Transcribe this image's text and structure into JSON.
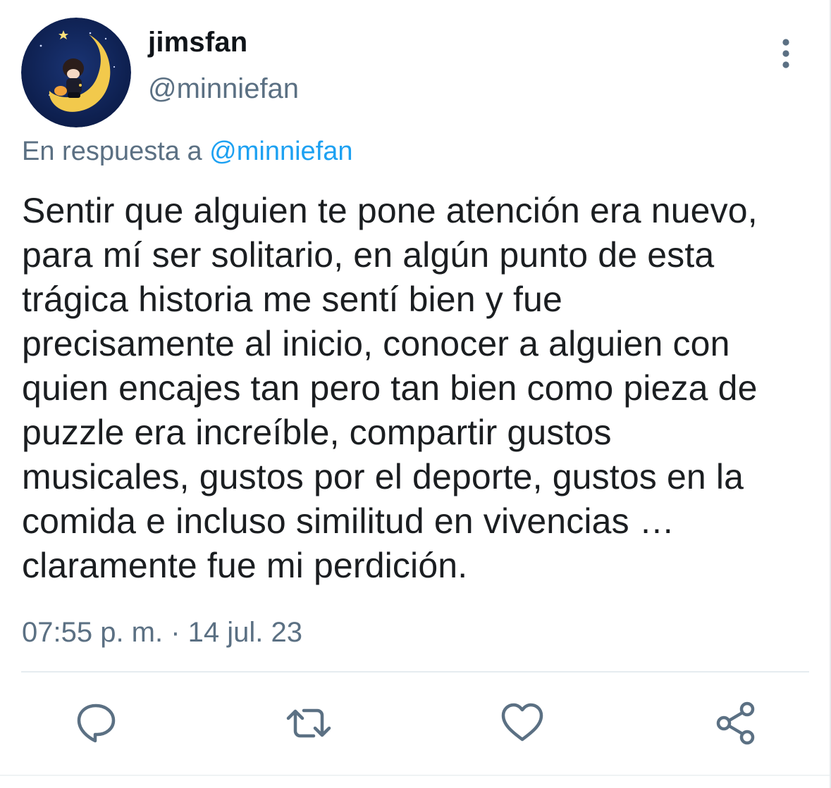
{
  "author": {
    "display_name": "jimsfan",
    "handle": "@minniefan",
    "avatar_icon": "moon-avatar"
  },
  "reply": {
    "prefix": "En respuesta a",
    "mention": "@minniefan"
  },
  "tweet": {
    "text": "Sentir que alguien te pone atención era nuevo,\npara mí ser solitario, en algún punto de esta\ntrágica historia me sentí bien y fue\nprecisamente al inicio, conocer a alguien con\nquien encajes tan pero tan bien como pieza de\npuzzle era increíble, compartir gustos\nmusicales, gustos por el deporte, gustos en la\ncomida e incluso similitud en vivencias …\nclaramente fue mi perdición.",
    "timestamp": "07:55 p. m. · 14 jul. 23"
  },
  "actions": {
    "reply_icon": "speech-bubble-icon",
    "retweet_icon": "retweet-icon",
    "like_icon": "heart-icon",
    "share_icon": "share-icon"
  },
  "colors": {
    "text": "#0f1419",
    "secondary": "#5b7083",
    "link": "#1da1f2",
    "icon": "#5b7083",
    "divider": "#e6ecf0",
    "avatar_bg": "#10245a",
    "moon": "#f2c94c"
  }
}
